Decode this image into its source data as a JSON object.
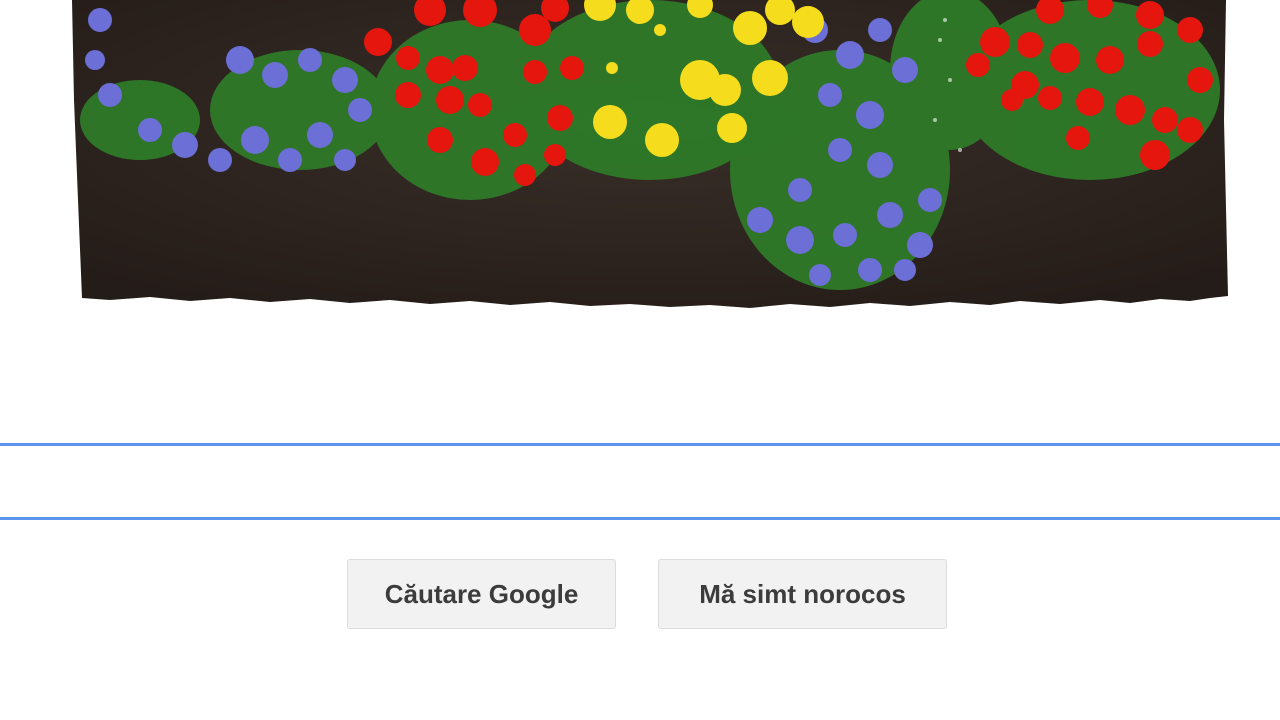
{
  "doodle": {
    "image": "flower-bed-doodle",
    "colors": {
      "soil": "#2e2520",
      "red": "#e3190f",
      "yellow": "#f7e01c",
      "violet": "#6a6fd3",
      "leaf": "#2f7a2a"
    }
  },
  "search": {
    "value": "",
    "placeholder": "",
    "border_color": "#5b95ee"
  },
  "buttons": {
    "search_label": "Căutare Google",
    "lucky_label": "Mă simt norocos"
  }
}
